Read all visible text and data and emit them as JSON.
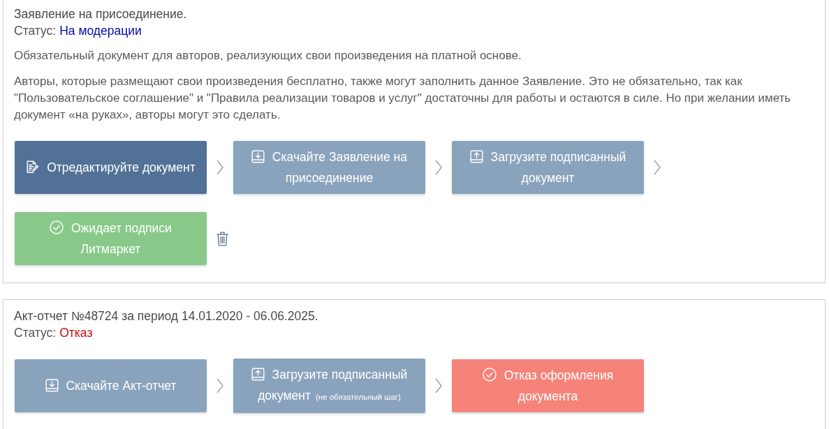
{
  "documents": [
    {
      "title": "Заявление на присоединение.",
      "status": {
        "label": "Статус:",
        "value": "На модерации",
        "kind": "moderation"
      },
      "paragraphs": [
        "Обязательный документ для авторов, реализующих свои произведения на платной основе.",
        "Авторы, которые размещают свои произведения бесплатно, также могут заполнить данное Заявление. Это не обязательно, так как \"Пользовательское соглашение\" и \"Правила реализации товаров и услуг\" достаточны для работы и остаются в силе. Но при желании иметь документ «на руках», авторы могут это сделать."
      ],
      "steps": [
        {
          "kind": "edit",
          "color": "#527196",
          "label": "Отредактируйте документ"
        },
        {
          "kind": "download",
          "color": "#8aa3bd",
          "label": "Скачайте Заявление на присоединение"
        },
        {
          "kind": "upload",
          "color": "#8aa3bd",
          "label": "Загрузите подписанный документ"
        },
        {
          "kind": "status",
          "color": "#88c98a",
          "label": "Ожидает подписи Литмаркет"
        }
      ],
      "deletable": true
    },
    {
      "title": "Акт-отчет №48724 за период 14.01.2020 - 06.06.2025.",
      "status": {
        "label": "Статус:",
        "value": "Отказ",
        "kind": "rejected"
      },
      "steps": [
        {
          "kind": "download",
          "color": "#8aa3bd",
          "label": "Скачайте Акт-отчет"
        },
        {
          "kind": "upload",
          "color": "#8aa3bd",
          "label": "Загрузите подписанный документ",
          "note": "(не обязательный шаг)"
        },
        {
          "kind": "status",
          "color": "#f5837a",
          "label": "Отказ оформления документа"
        }
      ],
      "deletable": false
    }
  ]
}
